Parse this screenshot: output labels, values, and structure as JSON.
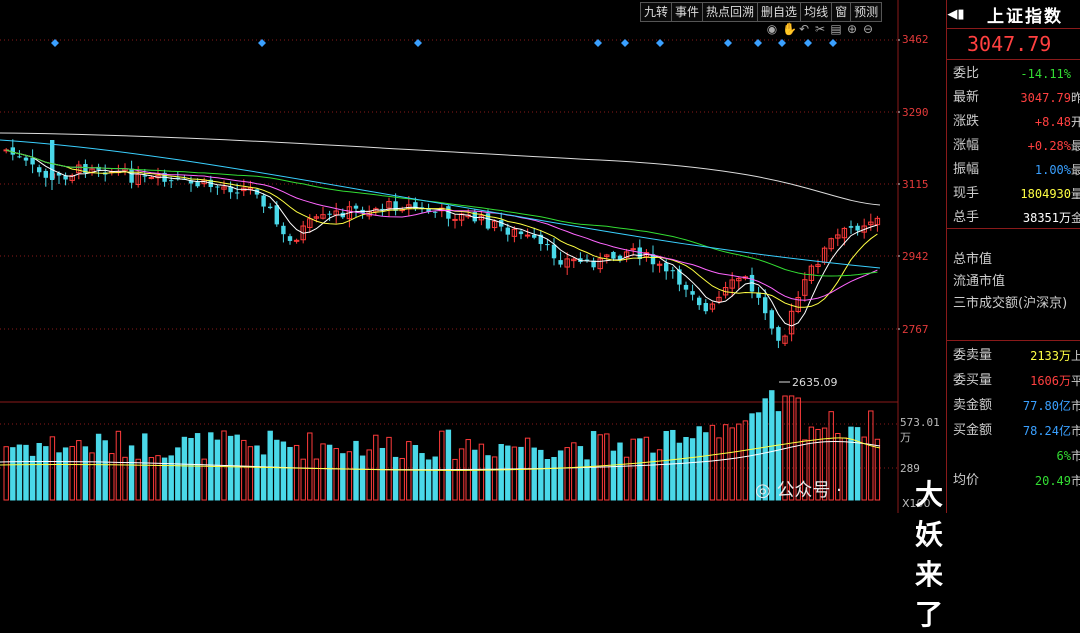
{
  "toolbar": {
    "items": [
      "九转",
      "事件",
      "热点回溯",
      "删自选",
      "均线",
      "窗",
      "预测"
    ],
    "icons": [
      "eye-icon",
      "hand-icon",
      "undo-icon",
      "scissors-icon",
      "trash-icon",
      "zoom-in-icon",
      "zoom-out-icon"
    ]
  },
  "y_axis": {
    "ticks": [
      "3462",
      "3290",
      "3115",
      "2942",
      "2767"
    ]
  },
  "volume_axis": {
    "top": "573.01万",
    "mid": "289",
    "unit": "X100"
  },
  "low_marker": "2635.09",
  "panel": {
    "title": "上证指数",
    "price": "3047.79",
    "rows": [
      {
        "k": "委比",
        "v": "-14.11%",
        "color": "#33dd33",
        "s": ""
      },
      {
        "k": "最新",
        "v": "3047.79",
        "color": "#ff4040",
        "s": "昨"
      },
      {
        "k": "涨跌",
        "v": "+8.48",
        "color": "#ff4040",
        "s": "开"
      },
      {
        "k": "涨幅",
        "v": "+0.28%",
        "color": "#ff4040",
        "s": "最"
      },
      {
        "k": "振幅",
        "v": "1.00%",
        "color": "#3aa0ff",
        "s": "最"
      },
      {
        "k": "现手",
        "v": "1804930",
        "color": "#ffff44",
        "s": "量"
      },
      {
        "k": "总手",
        "v": "38351万",
        "color": "#ffffff",
        "s": "金"
      }
    ],
    "info": [
      "总市值",
      "流通市值",
      "三市成交额(沪深京)"
    ],
    "rows2": [
      {
        "k": "委卖量",
        "v": "2133万",
        "color": "#ffff44",
        "s": "上"
      },
      {
        "k": "委买量",
        "v": "1606万",
        "color": "#ff4040",
        "s": "平"
      },
      {
        "k": "卖金额",
        "v": "77.80亿",
        "color": "#3aa0ff",
        "s": "市"
      },
      {
        "k": "买金额",
        "v": "78.24亿",
        "color": "#3aa0ff",
        "s": "市"
      },
      {
        "k": "",
        "v": "6%",
        "color": "#33dd33",
        "s": "市"
      },
      {
        "k": "均价",
        "v": "20.49",
        "color": "#33dd33",
        "s": "市"
      }
    ]
  },
  "watermark": {
    "text": "公众号 · ",
    "name": "大妖来了"
  },
  "colors": {
    "up": "#ff3b3b",
    "down": "#4ad8e8",
    "bg": "#000000",
    "grid": "#8a1a1a"
  }
}
